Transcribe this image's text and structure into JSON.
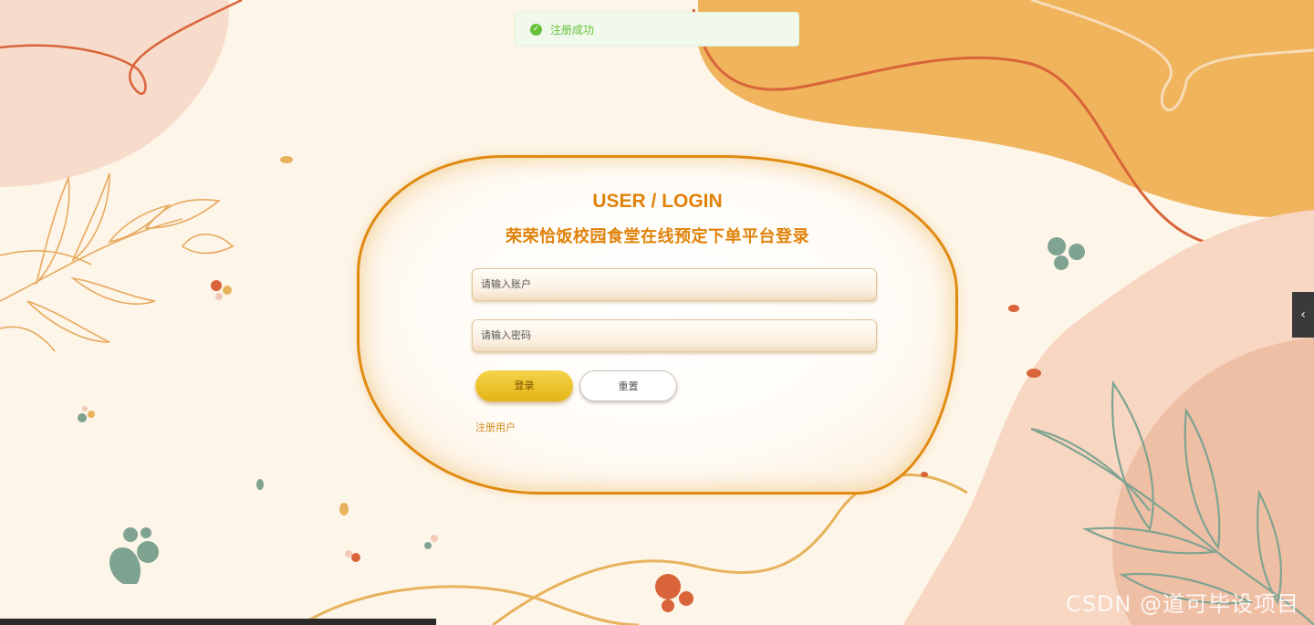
{
  "toast": {
    "icon": "check-circle-icon",
    "message": "注册成功",
    "color": "#67c23a"
  },
  "login": {
    "title_en": "USER / LOGIN",
    "title_cn": "荣荣恰饭校园食堂在线预定下单平台登录",
    "account_placeholder": "请输入账户",
    "password_placeholder": "请输入密码",
    "login_label": "登录",
    "reset_label": "重置",
    "register_link": "注册用户",
    "accent_color": "#e0820a"
  },
  "side_tab": {
    "icon": "chevron-left-icon",
    "glyph": "‹"
  },
  "watermark": "CSDN @道可毕设项目"
}
